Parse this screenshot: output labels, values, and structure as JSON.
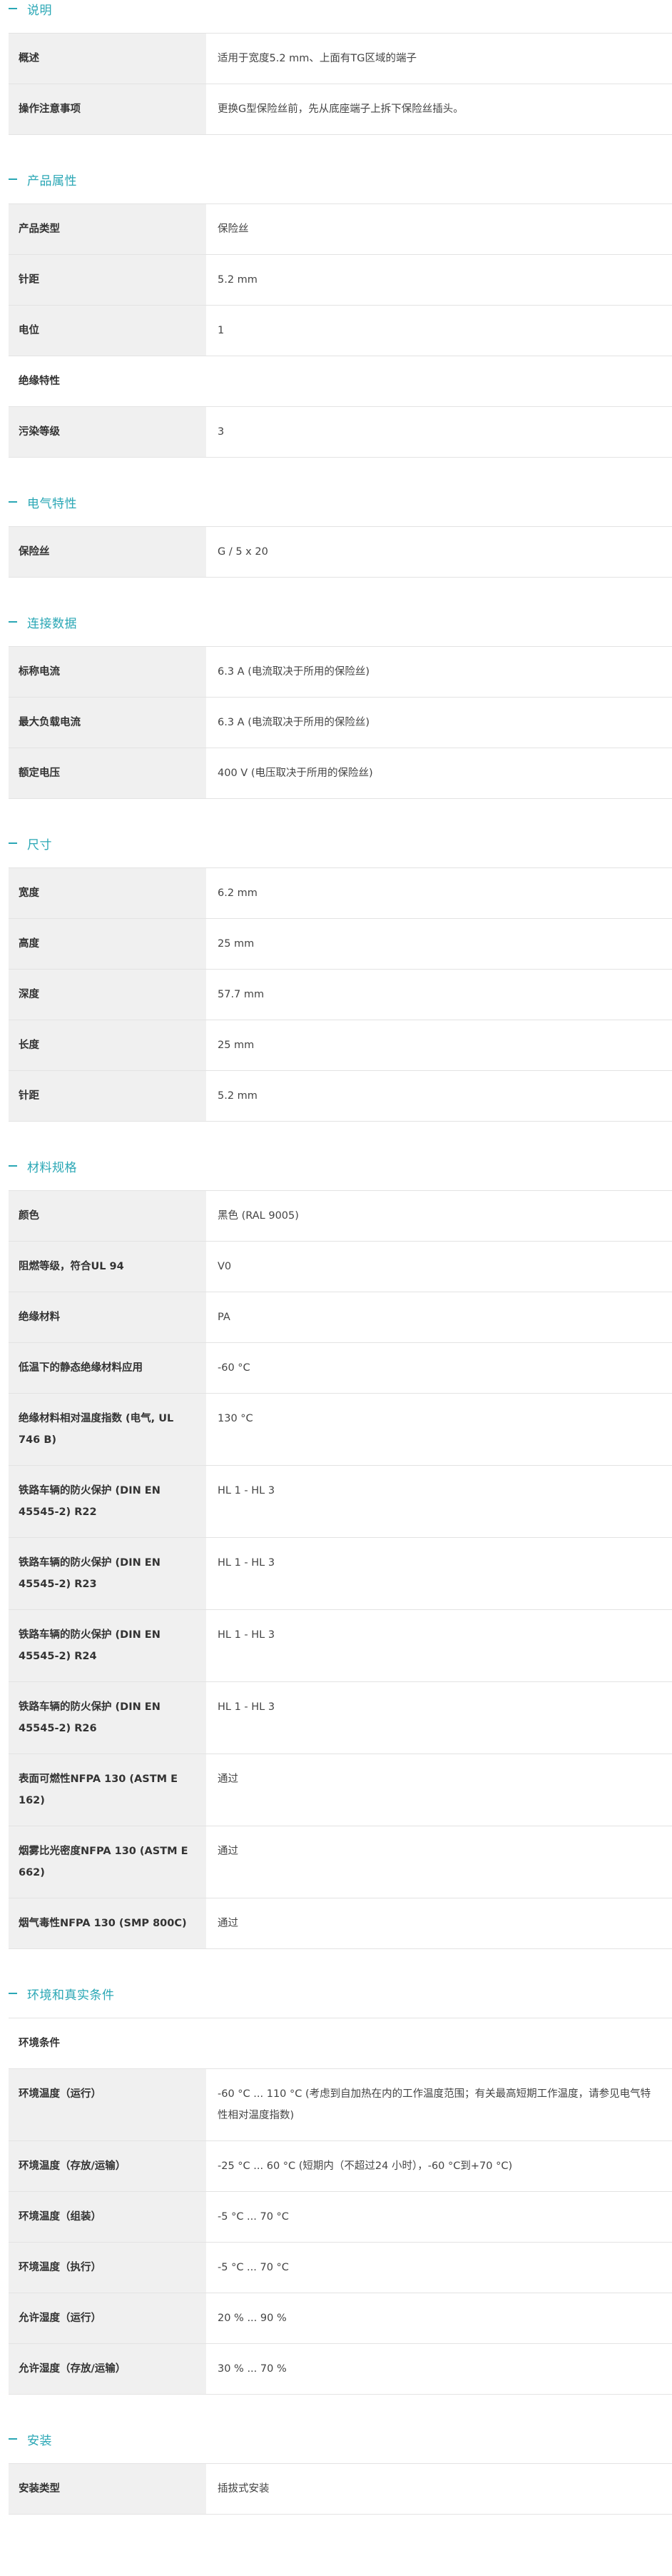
{
  "sections": [
    {
      "id": "description",
      "title": "说明",
      "rows": [
        {
          "type": "row",
          "label": "概述",
          "value": "适用于宽度5.2 mm、上面有TG区域的端子"
        },
        {
          "type": "row",
          "label": "操作注意事项",
          "value": "更换G型保险丝前，先从底座端子上拆下保险丝插头。"
        }
      ]
    },
    {
      "id": "product-properties",
      "title": "产品属性",
      "rows": [
        {
          "type": "row",
          "label": "产品类型",
          "value": "保险丝"
        },
        {
          "type": "row",
          "label": "针距",
          "value": "5.2 mm"
        },
        {
          "type": "row",
          "label": "电位",
          "value": "1"
        },
        {
          "type": "subhead",
          "label": "绝缘特性"
        },
        {
          "type": "row",
          "label": "污染等级",
          "value": "3"
        }
      ]
    },
    {
      "id": "electrical",
      "title": "电气特性",
      "rows": [
        {
          "type": "row",
          "label": "保险丝",
          "value": "G / 5 x 20"
        }
      ]
    },
    {
      "id": "connection",
      "title": "连接数据",
      "rows": [
        {
          "type": "row",
          "label": "标称电流",
          "value": "6.3 A (电流取决于所用的保险丝)"
        },
        {
          "type": "row",
          "label": "最大负载电流",
          "value": "6.3 A (电流取决于所用的保险丝)"
        },
        {
          "type": "row",
          "label": "额定电压",
          "value": "400 V (电压取决于所用的保险丝)"
        }
      ]
    },
    {
      "id": "dimensions",
      "title": "尺寸",
      "rows": [
        {
          "type": "row",
          "label": "宽度",
          "value": "6.2 mm"
        },
        {
          "type": "row",
          "label": "高度",
          "value": "25 mm"
        },
        {
          "type": "row",
          "label": "深度",
          "value": "57.7 mm"
        },
        {
          "type": "row",
          "label": "长度",
          "value": "25 mm"
        },
        {
          "type": "row",
          "label": "针距",
          "value": "5.2 mm"
        }
      ]
    },
    {
      "id": "materials",
      "title": "材料规格",
      "rows": [
        {
          "type": "row",
          "label": "颜色",
          "value": "黑色 (RAL 9005)"
        },
        {
          "type": "row",
          "label": "阻燃等级，符合UL 94",
          "value": "V0"
        },
        {
          "type": "row",
          "label": "绝缘材料",
          "value": "PA"
        },
        {
          "type": "row",
          "label": "低温下的静态绝缘材料应用",
          "value": "-60 °C"
        },
        {
          "type": "row",
          "label": "绝缘材料相对温度指数 (电气, UL 746 B)",
          "value": "130 °C"
        },
        {
          "type": "row",
          "label": "铁路车辆的防火保护 (DIN EN 45545-2) R22",
          "value": "HL 1 - HL 3"
        },
        {
          "type": "row",
          "label": "铁路车辆的防火保护 (DIN EN 45545-2) R23",
          "value": "HL 1 - HL 3"
        },
        {
          "type": "row",
          "label": "铁路车辆的防火保护 (DIN EN 45545-2) R24",
          "value": "HL 1 - HL 3"
        },
        {
          "type": "row",
          "label": "铁路车辆的防火保护 (DIN EN 45545-2) R26",
          "value": "HL 1 - HL 3"
        },
        {
          "type": "row",
          "label": "表面可燃性NFPA 130 (ASTM E 162)",
          "value": "通过"
        },
        {
          "type": "row",
          "label": "烟雾比光密度NFPA 130 (ASTM E 662)",
          "value": "通过"
        },
        {
          "type": "row",
          "label": "烟气毒性NFPA 130 (SMP 800C)",
          "value": "通过"
        }
      ]
    },
    {
      "id": "environment",
      "title": "环境和真实条件",
      "rows": [
        {
          "type": "subhead",
          "label": "环境条件"
        },
        {
          "type": "row",
          "label": "环境温度（运行）",
          "value": "-60 °C ... 110 °C (考虑到自加热在内的工作温度范围；有关最高短期工作温度，请参见电气特性相对温度指数)"
        },
        {
          "type": "row",
          "label": "环境温度（存放/运输）",
          "value": "-25 °C ... 60 °C (短期内（不超过24 小时），-60 °C到+70 °C)"
        },
        {
          "type": "row",
          "label": "环境温度（组装）",
          "value": "-5 °C ... 70 °C"
        },
        {
          "type": "row",
          "label": "环境温度（执行）",
          "value": "-5 °C ... 70 °C"
        },
        {
          "type": "row",
          "label": "允许湿度（运行）",
          "value": "20 % ... 90 %"
        },
        {
          "type": "row",
          "label": "允许湿度（存放/运输）",
          "value": "30 % ... 70 %"
        }
      ]
    },
    {
      "id": "mounting",
      "title": "安装",
      "rows": [
        {
          "type": "row",
          "label": "安装类型",
          "value": "插拔式安装"
        }
      ]
    }
  ],
  "colors": {
    "accent": "#2aa7b5",
    "label_bg": "#f0f0f0",
    "border": "#e3e3e3"
  }
}
